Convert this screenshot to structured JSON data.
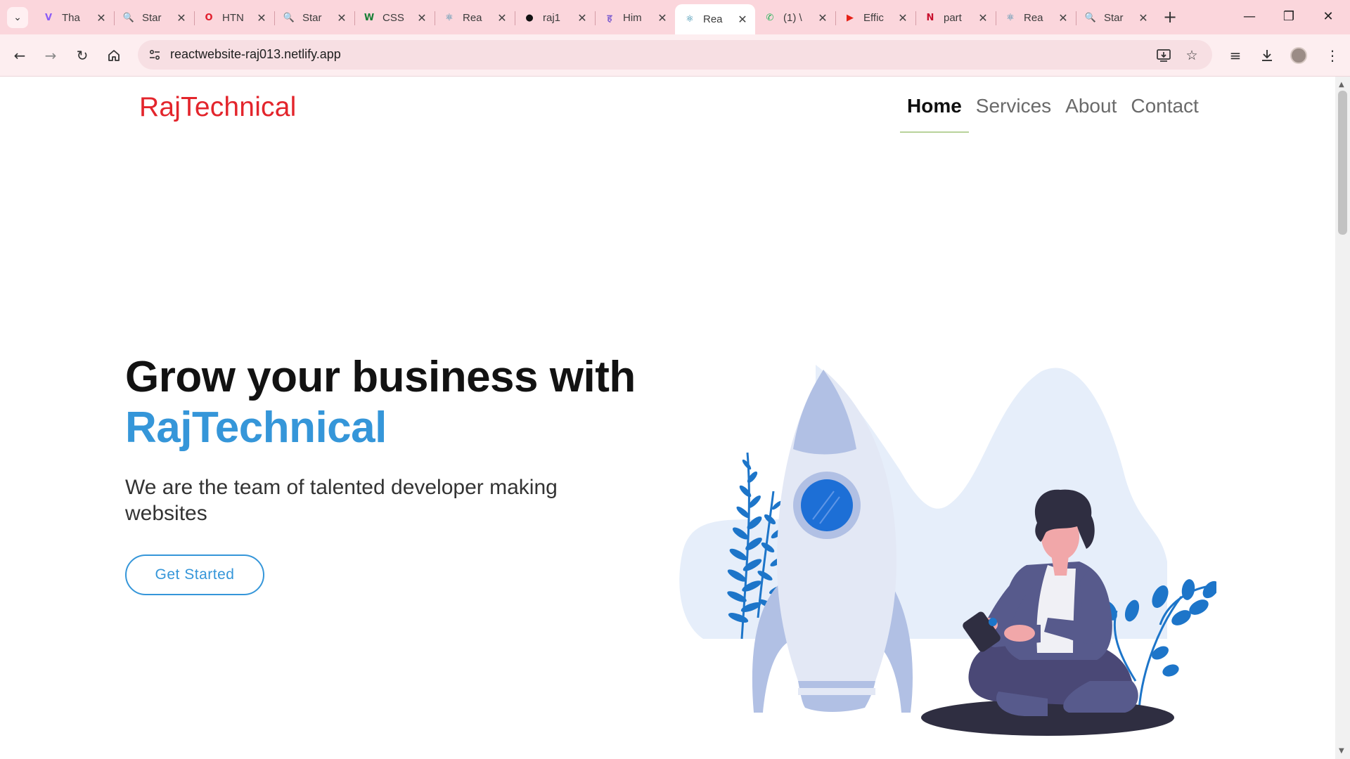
{
  "browser": {
    "tabs": [
      {
        "title": "Tha",
        "favicon": "V",
        "color": "#8b5cf6",
        "active": false
      },
      {
        "title": "Star",
        "favicon": "search-icon",
        "color": "#1e40af",
        "active": false
      },
      {
        "title": "HTN",
        "favicon": "opera-icon",
        "color": "#e11d2c",
        "active": false
      },
      {
        "title": "Star",
        "favicon": "search-icon",
        "color": "#1e40af",
        "active": false
      },
      {
        "title": "CSS",
        "favicon": "W",
        "color": "#1a7f37",
        "active": false
      },
      {
        "title": "Rea",
        "favicon": "react-icon",
        "color": "#1d7fa3",
        "active": false
      },
      {
        "title": "raj1",
        "favicon": "github-icon",
        "color": "#111111",
        "active": false
      },
      {
        "title": "Him",
        "favicon": "hindi-icon",
        "color": "#7c5ccf",
        "active": false
      },
      {
        "title": "Rea",
        "favicon": "react-icon",
        "color": "#1d7fa3",
        "active": true
      },
      {
        "title": "(1) \\",
        "favicon": "whatsapp-icon",
        "color": "#22b457",
        "active": false
      },
      {
        "title": "Effic",
        "favicon": "youtube-icon",
        "color": "#e62117",
        "active": false
      },
      {
        "title": "part",
        "favicon": "n-icon",
        "color": "#c8102e",
        "active": false
      },
      {
        "title": "Rea",
        "favicon": "react-icon",
        "color": "#1d7fa3",
        "active": false
      },
      {
        "title": "Star",
        "favicon": "search-icon",
        "color": "#1e40af",
        "active": false
      }
    ],
    "url": "reactwebsite-raj013.netlify.app"
  },
  "site": {
    "brand": "RajTechnical",
    "nav": [
      "Home",
      "Services",
      "About",
      "Contact"
    ],
    "active_nav": "Home",
    "hero": {
      "line1": "Grow your business with",
      "line2": "RajTechnical",
      "subtitle": "We are the team of talented developer making websites",
      "cta": "Get Started"
    }
  },
  "colors": {
    "brand_red": "#e3252c",
    "accent_blue": "#3596d9",
    "tabstrip_bg": "#fbd6dc",
    "rocket_light": "#b3c2e6",
    "person_suit": "#575a8c"
  }
}
